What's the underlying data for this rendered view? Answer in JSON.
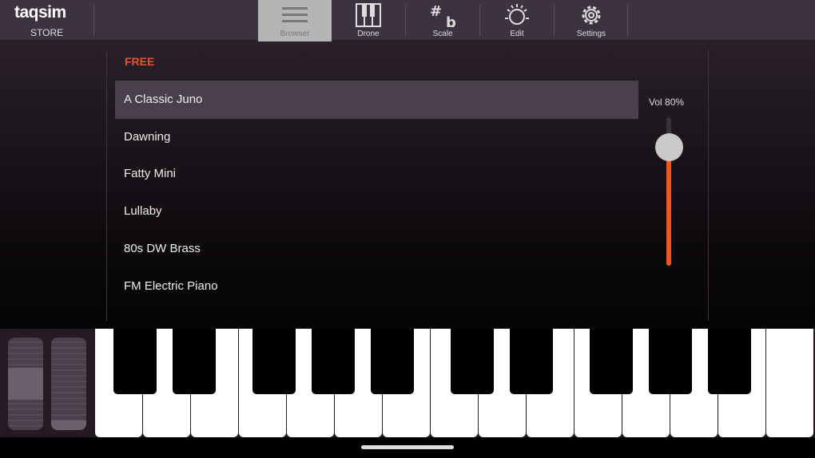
{
  "header": {
    "logo": "taqsim",
    "store": "STORE",
    "tabs": [
      {
        "label": "Browser",
        "icon": "hamburger-icon",
        "active": true
      },
      {
        "label": "Drone",
        "icon": "piano-icon"
      },
      {
        "label": "Scale",
        "icon": "sharp-flat-icon"
      },
      {
        "label": "Edit",
        "icon": "sun-knob-icon"
      },
      {
        "label": "Settings",
        "icon": "gear-icon"
      }
    ]
  },
  "browser": {
    "section": "FREE",
    "items": [
      "A Classic Juno",
      "Dawning",
      "Fatty Mini",
      "Lullaby",
      "80s DW Brass",
      "FM Electric Piano"
    ],
    "selected": 0
  },
  "volume": {
    "label": "Vol 80%",
    "value": 0.8
  },
  "colors": {
    "accent": "#f2561f",
    "topbar": "#3d3340"
  }
}
